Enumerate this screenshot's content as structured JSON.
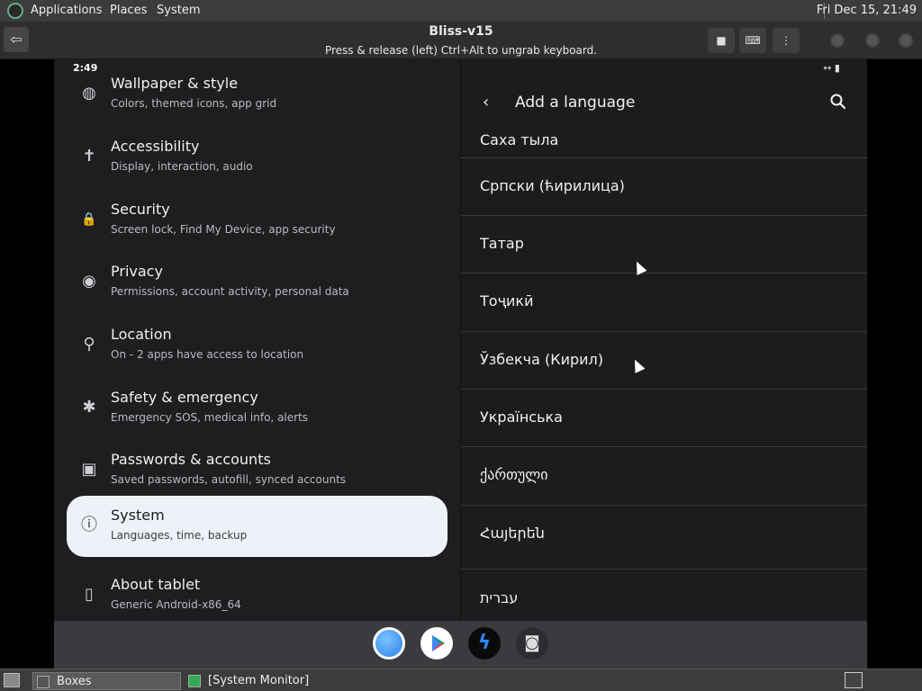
{
  "top_panel": {
    "menus": [
      "Applications",
      "Places",
      "System"
    ],
    "clock": "Fri Dec 15, 21:49"
  },
  "header": {
    "title": "Bliss-v15",
    "subtitle": "Press & release (left) Ctrl+Alt to ungrab keyboard."
  },
  "status_bar": {
    "time": "2:49",
    "icons": "↔ ▮"
  },
  "settings": {
    "items": [
      {
        "title": "Wallpaper & style",
        "subtitle": "Colors, themed icons, app grid",
        "icon": "palette-icon",
        "glyph": "◍"
      },
      {
        "title": "Accessibility",
        "subtitle": "Display, interaction, audio",
        "icon": "accessibility-icon",
        "glyph": "✝"
      },
      {
        "title": "Security",
        "subtitle": "Screen lock, Find My Device, app security",
        "icon": "lock-icon",
        "glyph": "🔒"
      },
      {
        "title": "Privacy",
        "subtitle": "Permissions, account activity, personal data",
        "icon": "eye-icon",
        "glyph": "◉"
      },
      {
        "title": "Location",
        "subtitle": "On - 2 apps have access to location",
        "icon": "location-pin-icon",
        "glyph": "⚲"
      },
      {
        "title": "Safety & emergency",
        "subtitle": "Emergency SOS, medical info, alerts",
        "icon": "asterisk-icon",
        "glyph": "✱"
      },
      {
        "title": "Passwords & accounts",
        "subtitle": "Saved passwords, autofill, synced accounts",
        "icon": "account-box-icon",
        "glyph": "▣"
      },
      {
        "title": "System",
        "subtitle": "Languages, time, backup",
        "icon": "info-icon",
        "glyph": "ⓘ"
      },
      {
        "title": "About tablet",
        "subtitle": "Generic Android-x86_64",
        "icon": "tablet-icon",
        "glyph": "▯"
      }
    ],
    "selected_index": 7
  },
  "language_pane": {
    "title": "Add a language",
    "back": "‹",
    "languages": [
      "Саха тыла",
      "Српски (ћирилица)",
      "Татар",
      "Тоҷикӣ",
      "Ўзбекча (Кирил)",
      "Українська",
      "ქართული",
      "Հայերեն",
      "עברית"
    ]
  },
  "taskbar": {
    "tasks": [
      "Boxes",
      "[System Monitor]"
    ]
  }
}
